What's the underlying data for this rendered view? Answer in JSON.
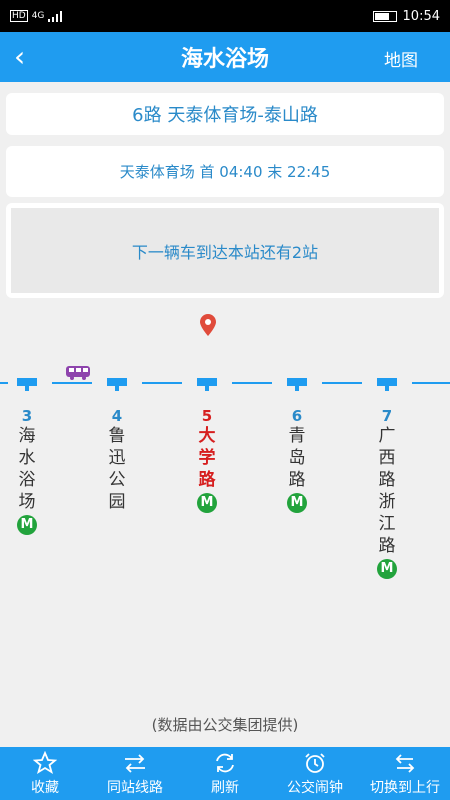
{
  "status": {
    "network": "4G",
    "time": "10:54"
  },
  "header": {
    "title": "海水浴场",
    "map_label": "地图"
  },
  "route": {
    "line_name": "6路 天泰体育场-泰山路",
    "schedule": "天泰体育场 首 04:40 末 22:45",
    "arrival_info": "下一辆车到达本站还有2站"
  },
  "stops": [
    {
      "num": "3",
      "name": "海水浴场",
      "metro": true,
      "current": false
    },
    {
      "num": "4",
      "name": "鲁迅公园",
      "metro": false,
      "current": false
    },
    {
      "num": "5",
      "name": "大学路",
      "metro": true,
      "current": true
    },
    {
      "num": "6",
      "name": "青岛路",
      "metro": true,
      "current": false
    },
    {
      "num": "7",
      "name": "广西路浙江路",
      "metro": true,
      "current": false
    }
  ],
  "source_note": "(数据由公交集团提供)",
  "tabs": [
    {
      "label": "收藏",
      "icon": "star-icon"
    },
    {
      "label": "同站线路",
      "icon": "swap-icon"
    },
    {
      "label": "刷新",
      "icon": "refresh-icon"
    },
    {
      "label": "公交闹钟",
      "icon": "alarm-clock-icon"
    },
    {
      "label": "切换到上行",
      "icon": "switch-direction-icon"
    }
  ],
  "colors": {
    "accent": "#1f9cf0",
    "current_stop": "#d61f1f",
    "metro": "#22a33c",
    "bus": "#8e44ad"
  }
}
